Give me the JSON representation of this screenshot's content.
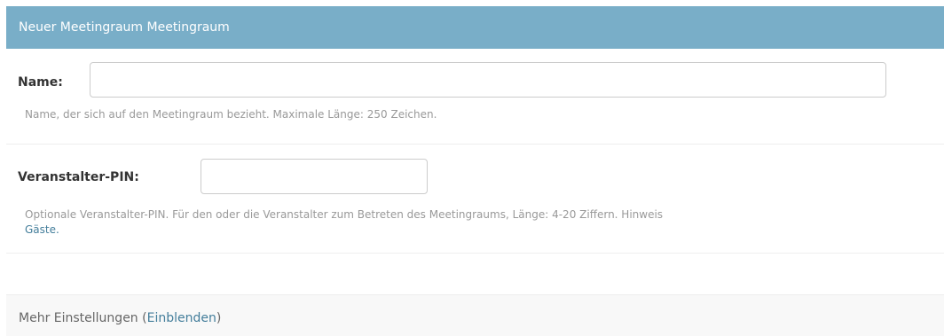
{
  "header": {
    "title": "Neuer Meetingraum Meetingraum"
  },
  "fields": {
    "name": {
      "label": "Name:",
      "value": "",
      "help": "Name, der sich auf den Meetingraum bezieht. Maximale Länge: 250 Zeichen."
    },
    "pin": {
      "label": "Veranstalter-PIN:",
      "value": "",
      "help_line1": "Optionale Veranstalter-PIN. Für den oder die Veranstalter zum Betreten des Meetingraums, Länge: 4-20 Ziffern. Hinweis",
      "help_link": "Gäste."
    }
  },
  "more_settings": {
    "label": "Mehr Einstellungen",
    "open_paren": " (",
    "toggle": "Einblenden",
    "close_paren": ")"
  },
  "colors": {
    "header_bg": "#79aec8",
    "link": "#447e9b",
    "help_text": "#999999"
  }
}
